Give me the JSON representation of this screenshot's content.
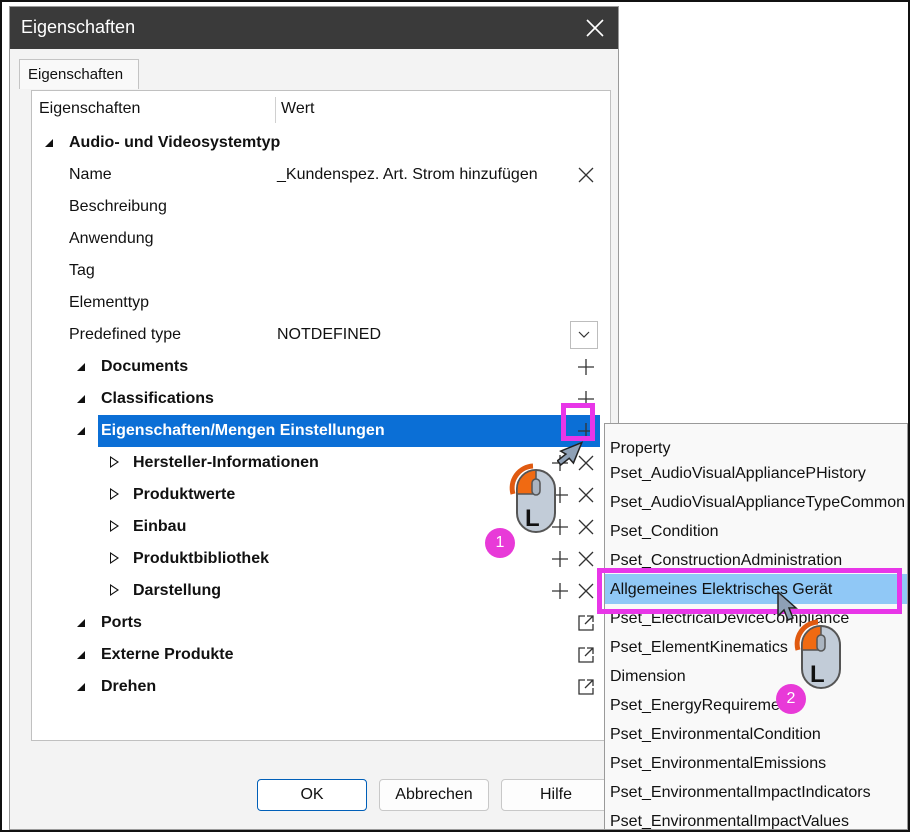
{
  "dialog": {
    "title": "Eigenschaften",
    "tab": "Eigenschaften",
    "columns": {
      "name": "Eigenschaften",
      "value": "Wert"
    }
  },
  "tree": {
    "root": "Audio- und Videosystemtyp",
    "props": [
      {
        "label": "Name",
        "value": "_Kundenspez. Art. Strom hinzufügen"
      },
      {
        "label": "Beschreibung",
        "value": ""
      },
      {
        "label": "Anwendung",
        "value": ""
      },
      {
        "label": "Tag",
        "value": ""
      },
      {
        "label": "Elementtyp",
        "value": ""
      },
      {
        "label": "Predefined type",
        "value": "NOTDEFINED"
      }
    ],
    "groups": {
      "documents": "Documents",
      "classifications": "Classifications",
      "eigenschaften": "Eigenschaften/Mengen Einstellungen",
      "ports": "Ports",
      "externe": "Externe Produkte",
      "drehen": "Drehen"
    },
    "subgroups": [
      "Hersteller-Informationen",
      "Produktwerte",
      "Einbau",
      "Produktbibliothek",
      "Darstellung"
    ]
  },
  "buttons": {
    "ok": "OK",
    "cancel": "Abbrechen",
    "help": "Hilfe"
  },
  "popup": {
    "items": [
      "Property",
      "Pset_AudioVisualAppliancePHistory",
      "Pset_AudioVisualApplianceTypeCommon",
      "Pset_Condition",
      "Pset_ConstructionAdministration",
      "Allgemeines Elektrisches Gerät",
      "Pset_ElectricalDeviceCompliance",
      "Pset_ElementKinematics",
      "Dimension",
      "Pset_EnergyRequirements",
      "Pset_EnvironmentalCondition",
      "Pset_EnvironmentalEmissions",
      "Pset_EnvironmentalImpactIndicators",
      "Pset_EnvironmentalImpactValues"
    ],
    "selected_index": 5
  },
  "annotations": {
    "step1": "1",
    "step2": "2",
    "mouse_letter": "L"
  },
  "colors": {
    "selection": "#0b6fd6",
    "highlight": "#e836e8",
    "popup_hover": "#90c8f6"
  }
}
